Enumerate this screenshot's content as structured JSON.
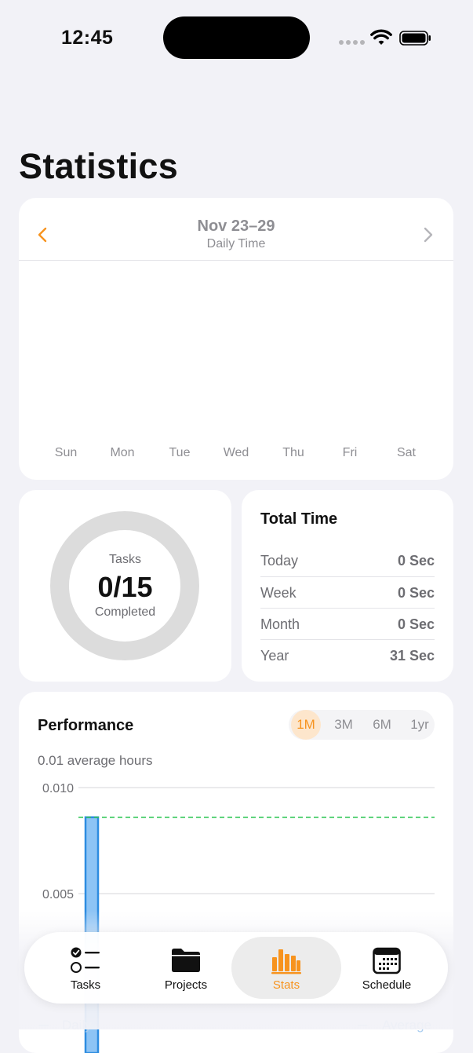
{
  "status_bar": {
    "time": "12:45"
  },
  "page_title": "Statistics",
  "week_card": {
    "range": "Nov 23–29",
    "subtitle": "Daily Time",
    "days": [
      "Sun",
      "Mon",
      "Tue",
      "Wed",
      "Thu",
      "Fri",
      "Sat"
    ]
  },
  "tasks_card": {
    "label_top": "Tasks",
    "value": "0/15",
    "label_bottom": "Completed",
    "progress": 0
  },
  "total_time": {
    "title": "Total Time",
    "rows": [
      {
        "label": "Today",
        "value": "0 Sec"
      },
      {
        "label": "Week",
        "value": "0 Sec"
      },
      {
        "label": "Month",
        "value": "0 Sec"
      },
      {
        "label": "Year",
        "value": "31 Sec"
      }
    ]
  },
  "performance": {
    "title": "Performance",
    "ranges": [
      "1M",
      "3M",
      "6M",
      "1yr"
    ],
    "selected_range": "1M",
    "summary": "0.01 average hours",
    "legend": {
      "left": "Daily",
      "right": "Average"
    }
  },
  "chart_data": {
    "type": "bar",
    "y_ticks": [
      "0.010",
      "0.005"
    ],
    "ylim": [
      0,
      0.01
    ],
    "series": [
      {
        "name": "Daily",
        "values": [
          0.0086
        ]
      },
      {
        "name": "Average",
        "values": [
          0.0086
        ]
      }
    ],
    "grid": true,
    "colors": {
      "bar": "#8dc4f5",
      "bar_stroke": "#2d8ce0",
      "average_line": "#34c759"
    }
  },
  "tab_bar": {
    "items": [
      {
        "label": "Tasks",
        "icon": "checklist-icon"
      },
      {
        "label": "Projects",
        "icon": "folder-icon"
      },
      {
        "label": "Stats",
        "icon": "bar-chart-icon"
      },
      {
        "label": "Schedule",
        "icon": "calendar-icon"
      }
    ],
    "active": "Stats"
  },
  "colors": {
    "accent": "#f7931e",
    "background": "#f2f2f7"
  }
}
